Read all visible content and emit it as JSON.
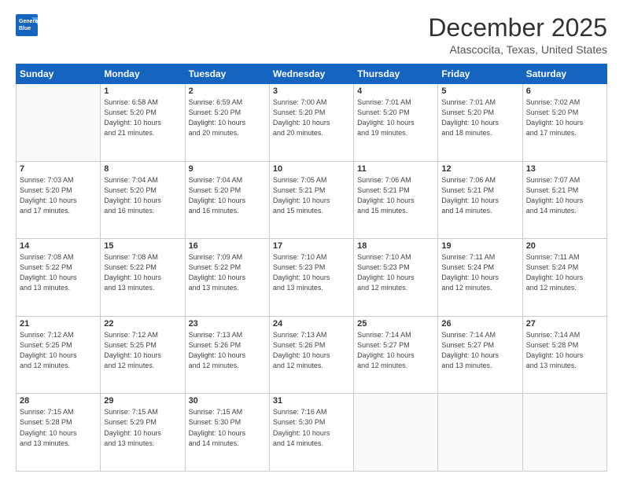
{
  "header": {
    "logo_line1": "General",
    "logo_line2": "Blue",
    "month": "December 2025",
    "location": "Atascocita, Texas, United States"
  },
  "weekdays": [
    "Sunday",
    "Monday",
    "Tuesday",
    "Wednesday",
    "Thursday",
    "Friday",
    "Saturday"
  ],
  "weeks": [
    [
      {
        "day": "",
        "info": ""
      },
      {
        "day": "1",
        "info": "Sunrise: 6:58 AM\nSunset: 5:20 PM\nDaylight: 10 hours\nand 21 minutes."
      },
      {
        "day": "2",
        "info": "Sunrise: 6:59 AM\nSunset: 5:20 PM\nDaylight: 10 hours\nand 20 minutes."
      },
      {
        "day": "3",
        "info": "Sunrise: 7:00 AM\nSunset: 5:20 PM\nDaylight: 10 hours\nand 20 minutes."
      },
      {
        "day": "4",
        "info": "Sunrise: 7:01 AM\nSunset: 5:20 PM\nDaylight: 10 hours\nand 19 minutes."
      },
      {
        "day": "5",
        "info": "Sunrise: 7:01 AM\nSunset: 5:20 PM\nDaylight: 10 hours\nand 18 minutes."
      },
      {
        "day": "6",
        "info": "Sunrise: 7:02 AM\nSunset: 5:20 PM\nDaylight: 10 hours\nand 17 minutes."
      }
    ],
    [
      {
        "day": "7",
        "info": "Sunrise: 7:03 AM\nSunset: 5:20 PM\nDaylight: 10 hours\nand 17 minutes."
      },
      {
        "day": "8",
        "info": "Sunrise: 7:04 AM\nSunset: 5:20 PM\nDaylight: 10 hours\nand 16 minutes."
      },
      {
        "day": "9",
        "info": "Sunrise: 7:04 AM\nSunset: 5:20 PM\nDaylight: 10 hours\nand 16 minutes."
      },
      {
        "day": "10",
        "info": "Sunrise: 7:05 AM\nSunset: 5:21 PM\nDaylight: 10 hours\nand 15 minutes."
      },
      {
        "day": "11",
        "info": "Sunrise: 7:06 AM\nSunset: 5:21 PM\nDaylight: 10 hours\nand 15 minutes."
      },
      {
        "day": "12",
        "info": "Sunrise: 7:06 AM\nSunset: 5:21 PM\nDaylight: 10 hours\nand 14 minutes."
      },
      {
        "day": "13",
        "info": "Sunrise: 7:07 AM\nSunset: 5:21 PM\nDaylight: 10 hours\nand 14 minutes."
      }
    ],
    [
      {
        "day": "14",
        "info": "Sunrise: 7:08 AM\nSunset: 5:22 PM\nDaylight: 10 hours\nand 13 minutes."
      },
      {
        "day": "15",
        "info": "Sunrise: 7:08 AM\nSunset: 5:22 PM\nDaylight: 10 hours\nand 13 minutes."
      },
      {
        "day": "16",
        "info": "Sunrise: 7:09 AM\nSunset: 5:22 PM\nDaylight: 10 hours\nand 13 minutes."
      },
      {
        "day": "17",
        "info": "Sunrise: 7:10 AM\nSunset: 5:23 PM\nDaylight: 10 hours\nand 13 minutes."
      },
      {
        "day": "18",
        "info": "Sunrise: 7:10 AM\nSunset: 5:23 PM\nDaylight: 10 hours\nand 12 minutes."
      },
      {
        "day": "19",
        "info": "Sunrise: 7:11 AM\nSunset: 5:24 PM\nDaylight: 10 hours\nand 12 minutes."
      },
      {
        "day": "20",
        "info": "Sunrise: 7:11 AM\nSunset: 5:24 PM\nDaylight: 10 hours\nand 12 minutes."
      }
    ],
    [
      {
        "day": "21",
        "info": "Sunrise: 7:12 AM\nSunset: 5:25 PM\nDaylight: 10 hours\nand 12 minutes."
      },
      {
        "day": "22",
        "info": "Sunrise: 7:12 AM\nSunset: 5:25 PM\nDaylight: 10 hours\nand 12 minutes."
      },
      {
        "day": "23",
        "info": "Sunrise: 7:13 AM\nSunset: 5:26 PM\nDaylight: 10 hours\nand 12 minutes."
      },
      {
        "day": "24",
        "info": "Sunrise: 7:13 AM\nSunset: 5:26 PM\nDaylight: 10 hours\nand 12 minutes."
      },
      {
        "day": "25",
        "info": "Sunrise: 7:14 AM\nSunset: 5:27 PM\nDaylight: 10 hours\nand 12 minutes."
      },
      {
        "day": "26",
        "info": "Sunrise: 7:14 AM\nSunset: 5:27 PM\nDaylight: 10 hours\nand 13 minutes."
      },
      {
        "day": "27",
        "info": "Sunrise: 7:14 AM\nSunset: 5:28 PM\nDaylight: 10 hours\nand 13 minutes."
      }
    ],
    [
      {
        "day": "28",
        "info": "Sunrise: 7:15 AM\nSunset: 5:28 PM\nDaylight: 10 hours\nand 13 minutes."
      },
      {
        "day": "29",
        "info": "Sunrise: 7:15 AM\nSunset: 5:29 PM\nDaylight: 10 hours\nand 13 minutes."
      },
      {
        "day": "30",
        "info": "Sunrise: 7:15 AM\nSunset: 5:30 PM\nDaylight: 10 hours\nand 14 minutes."
      },
      {
        "day": "31",
        "info": "Sunrise: 7:16 AM\nSunset: 5:30 PM\nDaylight: 10 hours\nand 14 minutes."
      },
      {
        "day": "",
        "info": ""
      },
      {
        "day": "",
        "info": ""
      },
      {
        "day": "",
        "info": ""
      }
    ]
  ]
}
